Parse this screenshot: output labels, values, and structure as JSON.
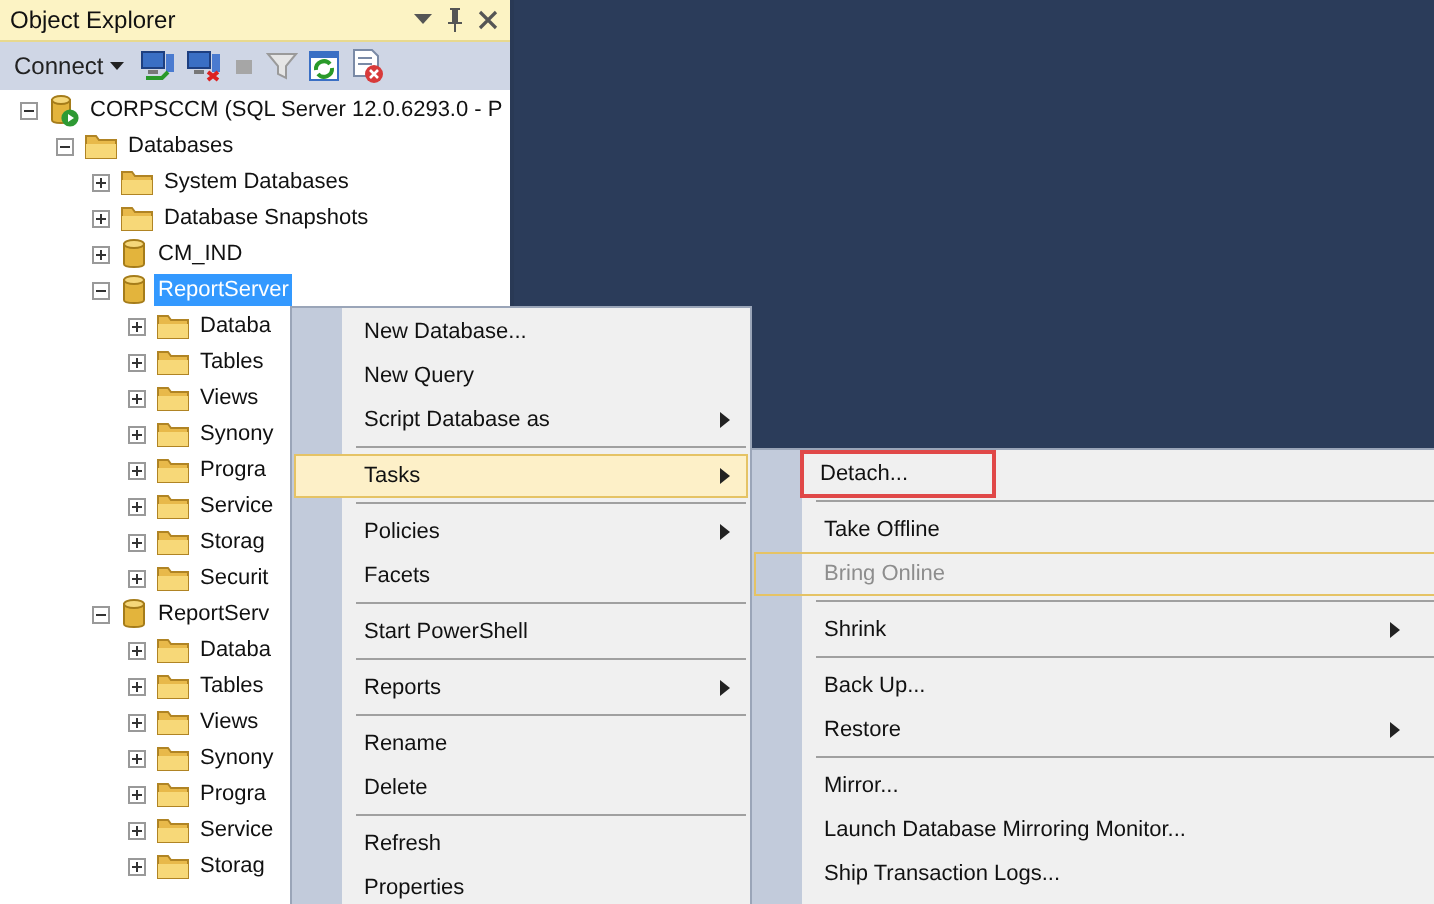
{
  "panel": {
    "title": "Object Explorer",
    "connect_label": "Connect"
  },
  "tree": [
    {
      "label": "CORPSCCM (SQL Server 12.0.6293.0 - P",
      "kind": "server",
      "expanded": true,
      "selected": false,
      "children": [
        {
          "label": "Databases",
          "kind": "folder",
          "expanded": true,
          "selected": false,
          "children": [
            {
              "label": "System Databases",
              "kind": "folder",
              "expanded": false,
              "selected": false
            },
            {
              "label": "Database Snapshots",
              "kind": "folder",
              "expanded": false,
              "selected": false
            },
            {
              "label": "CM_IND",
              "kind": "database",
              "expanded": false,
              "selected": false
            },
            {
              "label": "ReportServer",
              "kind": "database",
              "expanded": true,
              "selected": true,
              "children": [
                {
                  "label": "Databa",
                  "kind": "folder",
                  "expanded": false,
                  "selected": false
                },
                {
                  "label": "Tables",
                  "kind": "folder",
                  "expanded": false,
                  "selected": false
                },
                {
                  "label": "Views",
                  "kind": "folder",
                  "expanded": false,
                  "selected": false
                },
                {
                  "label": "Synony",
                  "kind": "folder",
                  "expanded": false,
                  "selected": false
                },
                {
                  "label": "Progra",
                  "kind": "folder",
                  "expanded": false,
                  "selected": false
                },
                {
                  "label": "Service",
                  "kind": "folder",
                  "expanded": false,
                  "selected": false
                },
                {
                  "label": "Storag",
                  "kind": "folder",
                  "expanded": false,
                  "selected": false
                },
                {
                  "label": "Securit",
                  "kind": "folder",
                  "expanded": false,
                  "selected": false
                }
              ]
            },
            {
              "label": "ReportServ",
              "kind": "database",
              "expanded": true,
              "selected": false,
              "children": [
                {
                  "label": "Databa",
                  "kind": "folder",
                  "expanded": false,
                  "selected": false
                },
                {
                  "label": "Tables",
                  "kind": "folder",
                  "expanded": false,
                  "selected": false
                },
                {
                  "label": "Views",
                  "kind": "folder",
                  "expanded": false,
                  "selected": false
                },
                {
                  "label": "Synony",
                  "kind": "folder",
                  "expanded": false,
                  "selected": false
                },
                {
                  "label": "Progra",
                  "kind": "folder",
                  "expanded": false,
                  "selected": false
                },
                {
                  "label": "Service",
                  "kind": "folder",
                  "expanded": false,
                  "selected": false
                },
                {
                  "label": "Storag",
                  "kind": "folder",
                  "expanded": false,
                  "selected": false
                }
              ]
            }
          ]
        }
      ]
    }
  ],
  "context_menu": [
    {
      "kind": "item",
      "label": "New Database...",
      "submenu": false,
      "selected": false,
      "disabled": false
    },
    {
      "kind": "item",
      "label": "New Query",
      "submenu": false,
      "selected": false,
      "disabled": false
    },
    {
      "kind": "item",
      "label": "Script Database as",
      "submenu": true,
      "selected": false,
      "disabled": false
    },
    {
      "kind": "separator"
    },
    {
      "kind": "item",
      "label": "Tasks",
      "submenu": true,
      "selected": true,
      "disabled": false
    },
    {
      "kind": "separator"
    },
    {
      "kind": "item",
      "label": "Policies",
      "submenu": true,
      "selected": false,
      "disabled": false
    },
    {
      "kind": "item",
      "label": "Facets",
      "submenu": false,
      "selected": false,
      "disabled": false
    },
    {
      "kind": "separator"
    },
    {
      "kind": "item",
      "label": "Start PowerShell",
      "submenu": false,
      "selected": false,
      "disabled": false
    },
    {
      "kind": "separator"
    },
    {
      "kind": "item",
      "label": "Reports",
      "submenu": true,
      "selected": false,
      "disabled": false
    },
    {
      "kind": "separator"
    },
    {
      "kind": "item",
      "label": "Rename",
      "submenu": false,
      "selected": false,
      "disabled": false
    },
    {
      "kind": "item",
      "label": "Delete",
      "submenu": false,
      "selected": false,
      "disabled": false
    },
    {
      "kind": "separator"
    },
    {
      "kind": "item",
      "label": "Refresh",
      "submenu": false,
      "selected": false,
      "disabled": false
    },
    {
      "kind": "item",
      "label": "Properties",
      "submenu": false,
      "selected": false,
      "disabled": false
    }
  ],
  "tasks_submenu": [
    {
      "kind": "item",
      "label": "Detach...",
      "submenu": false,
      "selected": false,
      "disabled": false,
      "outlined": true
    },
    {
      "kind": "separator"
    },
    {
      "kind": "item",
      "label": "Take Offline",
      "submenu": false,
      "selected": false,
      "disabled": false,
      "outlined": false
    },
    {
      "kind": "item",
      "label": "Bring Online",
      "submenu": false,
      "selected": true,
      "disabled": true,
      "outlined": false
    },
    {
      "kind": "separator"
    },
    {
      "kind": "item",
      "label": "Shrink",
      "submenu": true,
      "selected": false,
      "disabled": false,
      "outlined": false
    },
    {
      "kind": "separator"
    },
    {
      "kind": "item",
      "label": "Back Up...",
      "submenu": false,
      "selected": false,
      "disabled": false,
      "outlined": false
    },
    {
      "kind": "item",
      "label": "Restore",
      "submenu": true,
      "selected": false,
      "disabled": false,
      "outlined": false
    },
    {
      "kind": "separator"
    },
    {
      "kind": "item",
      "label": "Mirror...",
      "submenu": false,
      "selected": false,
      "disabled": false,
      "outlined": false
    },
    {
      "kind": "item",
      "label": "Launch Database Mirroring Monitor...",
      "submenu": false,
      "selected": false,
      "disabled": false,
      "outlined": false
    },
    {
      "kind": "item",
      "label": "Ship Transaction Logs...",
      "submenu": false,
      "selected": false,
      "disabled": false,
      "outlined": false
    }
  ]
}
